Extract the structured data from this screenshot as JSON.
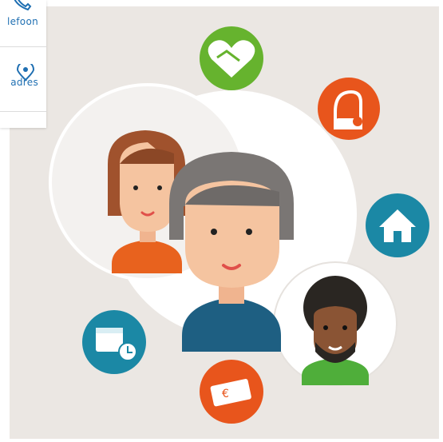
{
  "contact": {
    "phone_label": "lefoon",
    "address_label": "adres",
    "phone_icon": "phone-icon",
    "address_icon": "map-pin-icon"
  },
  "illustration": {
    "icons": [
      "heart-handshake-icon",
      "vacuum-cleaner-icon",
      "home-icon",
      "calendar-clock-icon",
      "money-euro-icon"
    ],
    "people": [
      "woman-avatar",
      "older-woman-avatar",
      "man-avatar"
    ]
  },
  "colors": {
    "background": "#ebe7e3",
    "link_blue": "#1f6fb2",
    "green": "#66b32e",
    "orange": "#e8551c",
    "teal": "#1b88a5"
  }
}
